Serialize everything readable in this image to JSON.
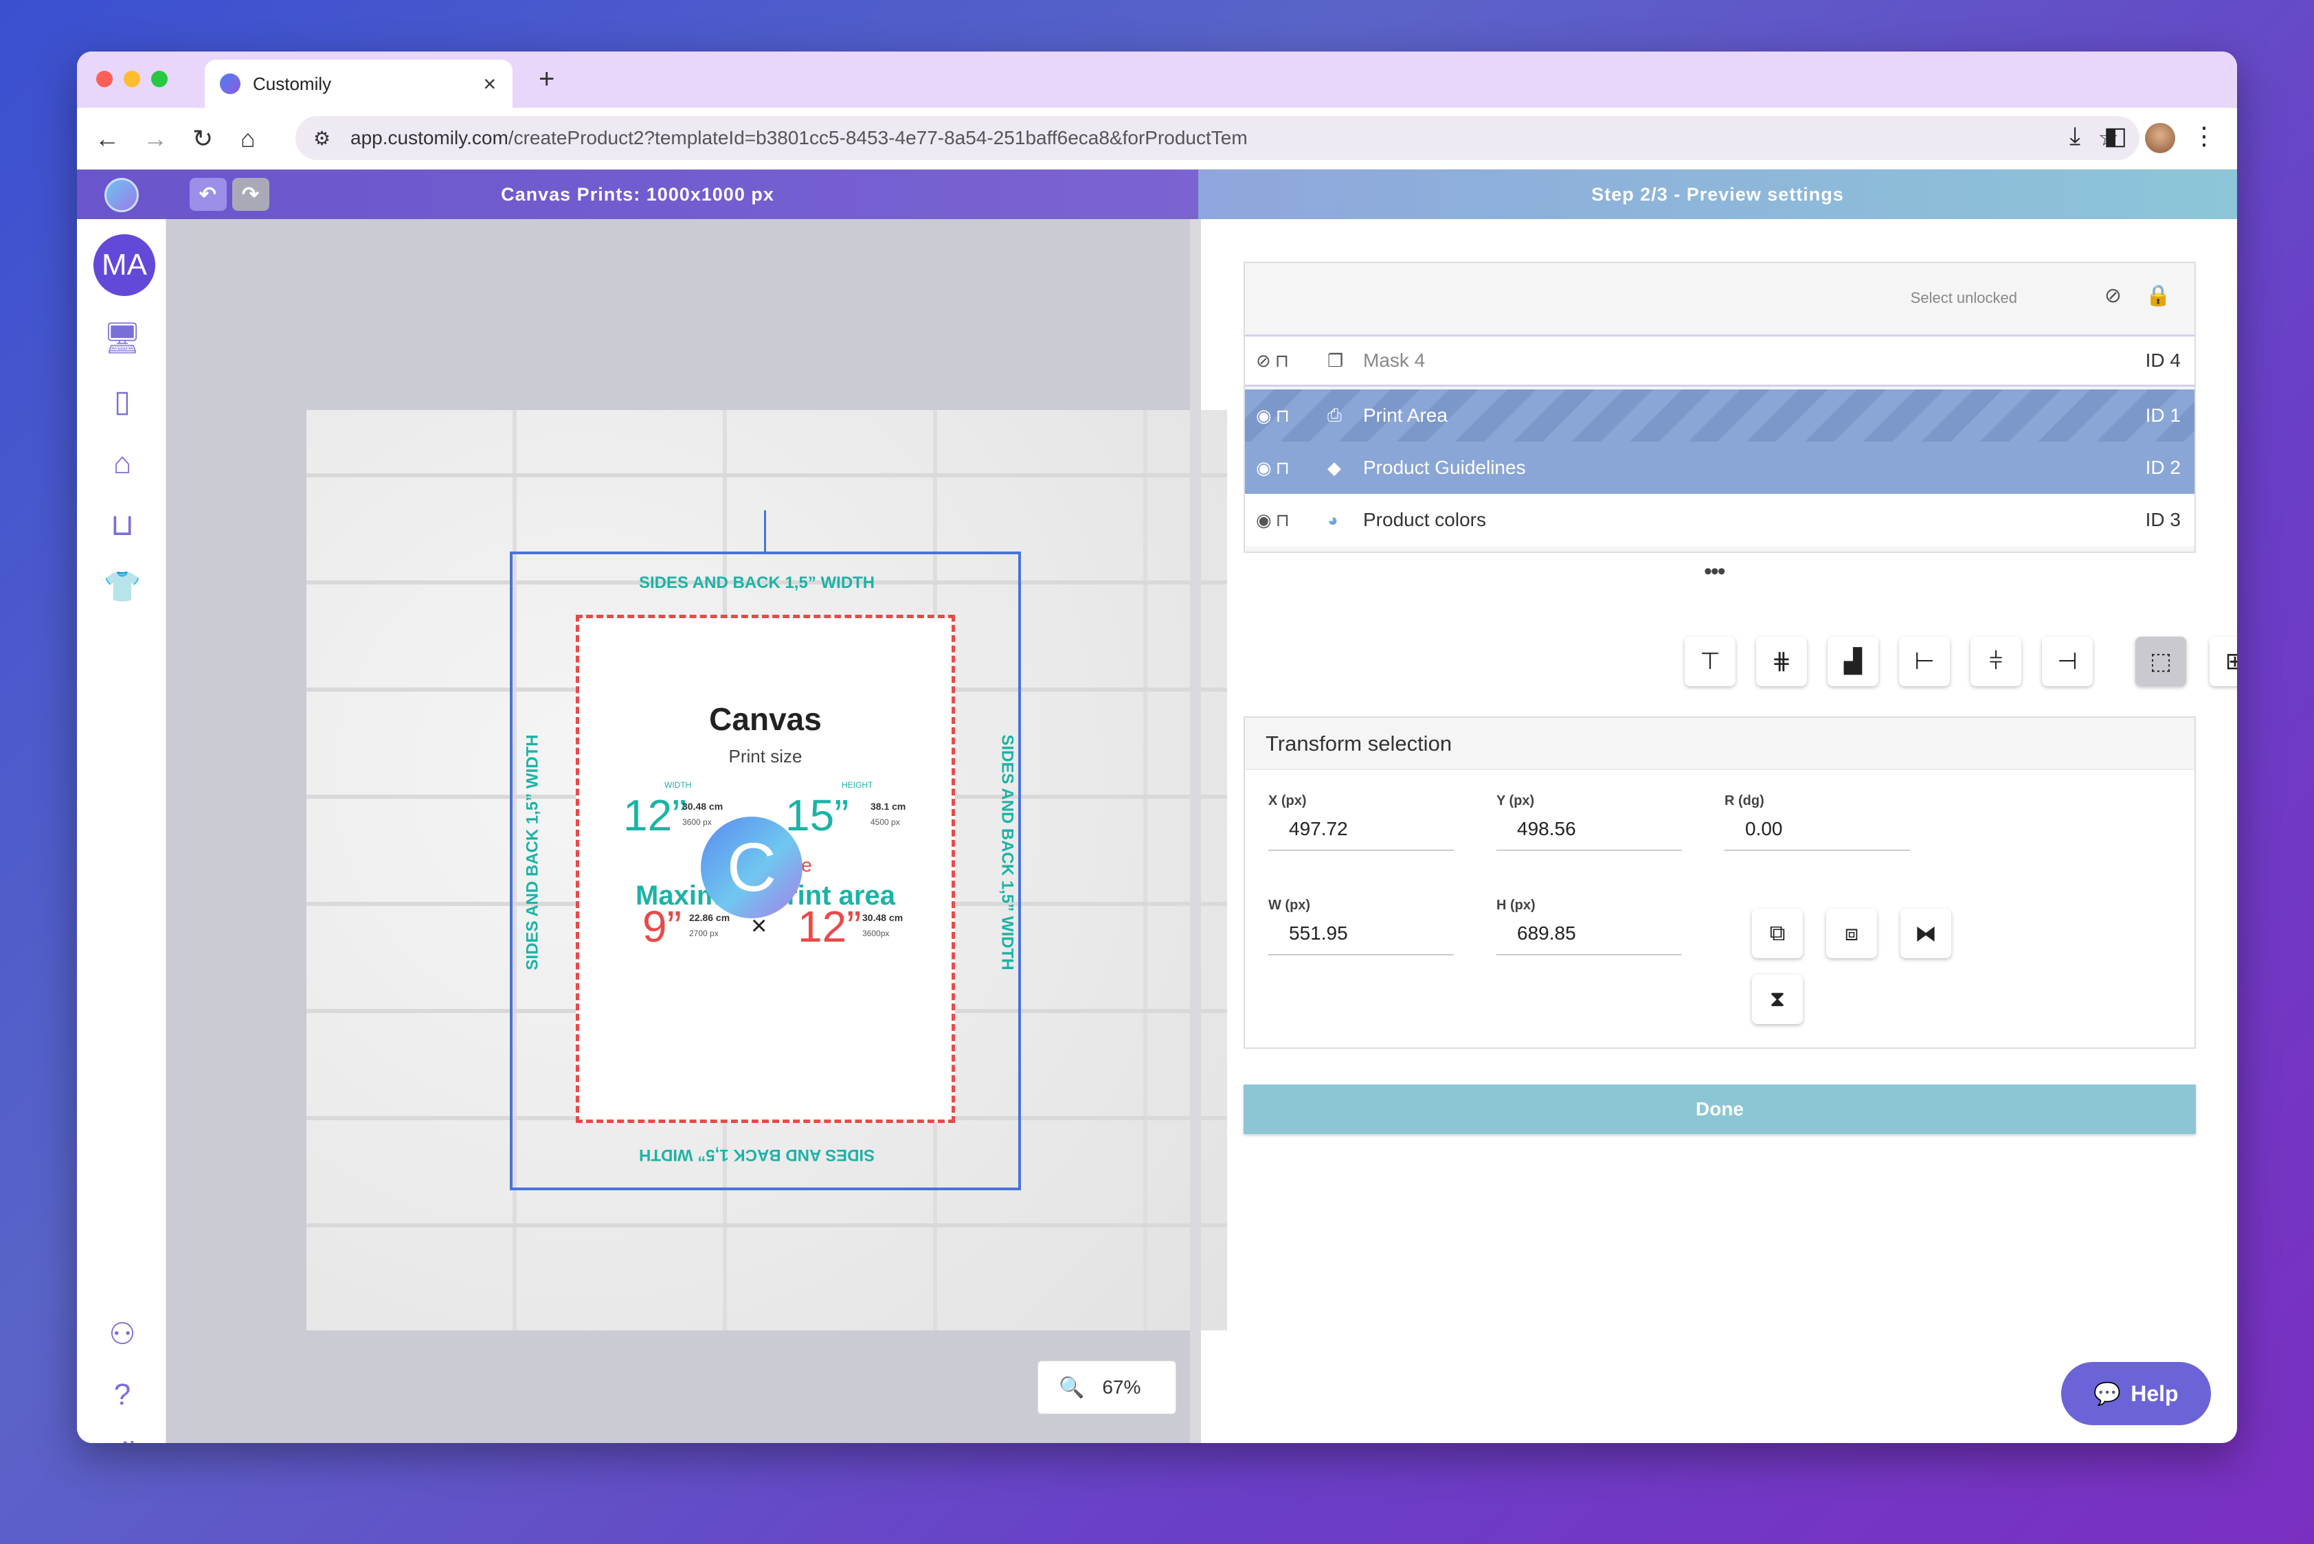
{
  "browser": {
    "tab_title": "Customily",
    "new_tab": "+",
    "close_tab": "×",
    "url_domain": "app.customily.com",
    "url_path": "/createProduct2?templateId=b3801cc5-8453-4e77-8a54-251baff6eca8&forProductTem"
  },
  "header": {
    "left_title": "Canvas Prints: 1000x1000 px",
    "right_title": "Step 2/3 - Preview settings",
    "undo": "↶",
    "redo": "↷"
  },
  "sidebar": {
    "avatar_initials": "MA"
  },
  "canvas": {
    "side_label": "SIDES AND BACK 1,5” WIDTH",
    "card_title": "Canvas",
    "card_sub": "Print size",
    "width_label": "WIDTH",
    "height_label": "HEIGHT",
    "w_big": "12”",
    "h_big": "15”",
    "w_cm": "30.48 cm",
    "w_px": "3600 px",
    "h_cm": "38.1 cm",
    "h_px": "4500 px",
    "actual": "Actual size",
    "max_area": "Maximum print area",
    "m_w_big": "9”",
    "m_h_big": "12”",
    "m_w_cm": "22.86 cm",
    "m_w_px": "2700 px",
    "m_h_cm": "30.48 cm",
    "m_h_px": "3600px",
    "times": "×",
    "zoom": "67%"
  },
  "layers": {
    "select_unlocked": "Select unlocked",
    "rows": [
      {
        "name": "Mask 4",
        "id": "ID 4"
      },
      {
        "name": "Print Area",
        "id": "ID 1"
      },
      {
        "name": "Product Guidelines",
        "id": "ID 2"
      },
      {
        "name": "Product colors",
        "id": "ID 3"
      }
    ]
  },
  "transform": {
    "title": "Transform selection",
    "x_label": "X (px)",
    "x_value": "497.72",
    "y_label": "Y (px)",
    "y_value": "498.56",
    "r_label": "R (dg)",
    "r_value": "0.00",
    "w_label": "W (px)",
    "w_value": "551.95",
    "h_label": "H (px)",
    "h_value": "689.85"
  },
  "done_label": "Done",
  "help_label": "Help",
  "colors": {
    "accent": "#6a55cc",
    "teal": "#1bb3a6",
    "red": "#e84a4a",
    "selected_layer": "#8aa6d6",
    "done": "#8cc6d5",
    "help": "#6b64d8"
  }
}
